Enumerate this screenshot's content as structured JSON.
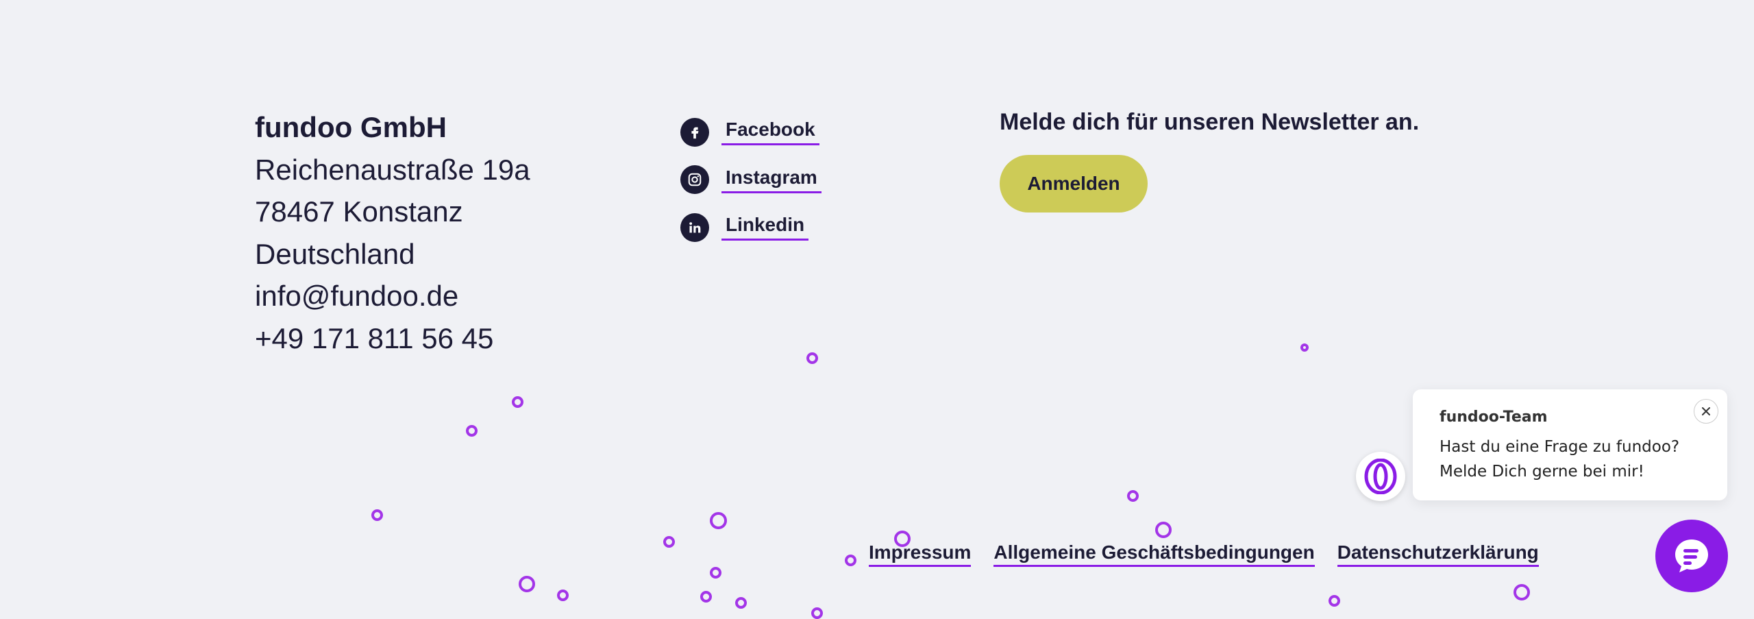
{
  "address": {
    "company": "fundoo GmbH",
    "street": "Reichenaustraße 19a",
    "city": "78467 Konstanz",
    "country": "Deutschland",
    "email": "info@fundoo.de",
    "phone": "+49 171 811 56 45"
  },
  "social": [
    {
      "label": "Facebook",
      "icon": "facebook-icon"
    },
    {
      "label": "Instagram",
      "icon": "instagram-icon"
    },
    {
      "label": "Linkedin",
      "icon": "linkedin-icon"
    }
  ],
  "newsletter": {
    "title": "Melde dich für unseren Newsletter an.",
    "button_label": "Anmelden"
  },
  "legal": [
    {
      "label": "Impressum"
    },
    {
      "label": "Allgemeine Geschäftsbedingungen"
    },
    {
      "label": "Datenschutzerklärung"
    }
  ],
  "chat": {
    "sender": "fundoo-Team",
    "message_line1": "Hast du eine Frage zu fundoo?",
    "message_line2": "Melde Dich gerne bei mir!",
    "close_icon": "close-icon",
    "avatar_icon": "fundoo-logo-icon",
    "launcher_icon": "chat-bubble-icon"
  },
  "colors": {
    "background": "#f0f1f5",
    "text": "#1c1b35",
    "accent": "#8a1ce6",
    "button": "#cdcb57"
  }
}
